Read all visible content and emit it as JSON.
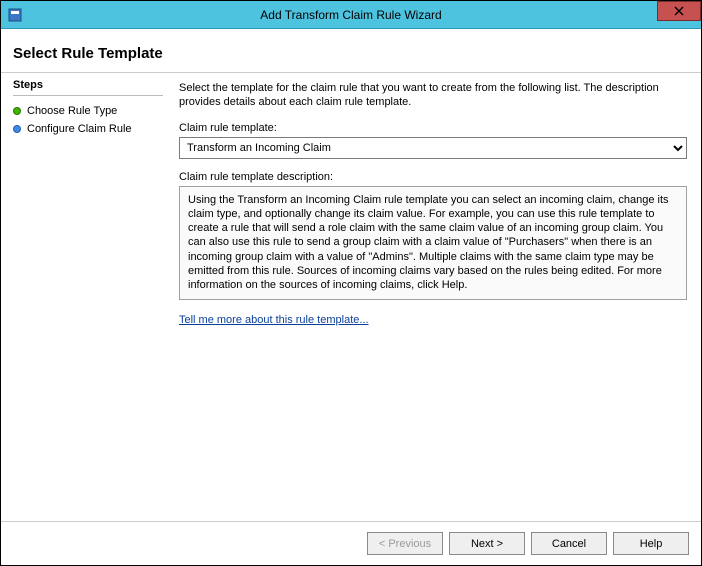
{
  "window": {
    "title": "Add Transform Claim Rule Wizard"
  },
  "header": {
    "title": "Select Rule Template"
  },
  "sidebar": {
    "heading": "Steps",
    "items": [
      {
        "label": "Choose Rule Type",
        "state": "active"
      },
      {
        "label": "Configure Claim Rule",
        "state": "pending"
      }
    ]
  },
  "main": {
    "intro": "Select the template for the claim rule that you want to create from the following list. The description provides details about each claim rule template.",
    "template_label": "Claim rule template:",
    "template_value": "Transform an Incoming Claim",
    "description_label": "Claim rule template description:",
    "description_text": "Using the Transform an Incoming Claim rule template you can select an incoming claim, change its claim type, and optionally change its claim value.  For example, you can use this rule template to create a rule that will send a role claim with the same claim value of an incoming group claim.  You can also use this rule to send a group claim with a claim value of \"Purchasers\" when there is an incoming group claim with a value of \"Admins\".  Multiple claims with the same claim type may be emitted from this rule. Sources of incoming claims vary based on the rules being edited.  For more information on the sources of incoming claims, click Help.",
    "more_link": "Tell me more about this rule template..."
  },
  "footer": {
    "previous": "< Previous",
    "next": "Next >",
    "cancel": "Cancel",
    "help": "Help"
  }
}
